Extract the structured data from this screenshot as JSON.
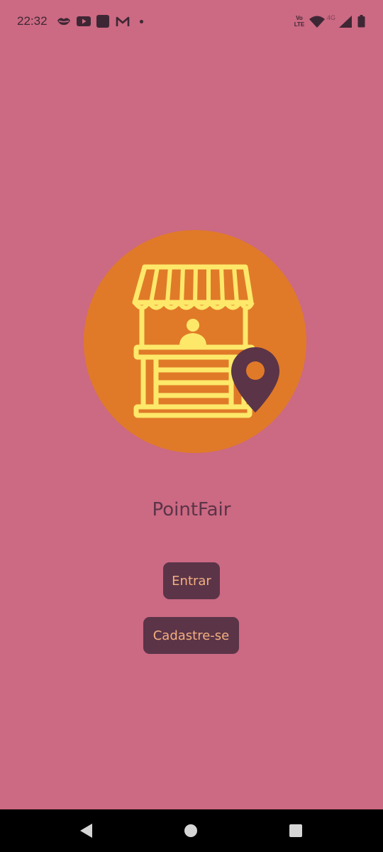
{
  "status_bar": {
    "time": "22:32",
    "network_label": "4G",
    "volte_label_top": "Vo",
    "volte_label_bottom": "LTE"
  },
  "app": {
    "title": "PointFair"
  },
  "buttons": {
    "login_label": "Entrar",
    "signup_label": "Cadastre-se"
  },
  "colors": {
    "background": "#cc6983",
    "logo_circle": "#e07a28",
    "stall": "#fde86a",
    "pin": "#5b3448",
    "button_bg": "#5b3448",
    "button_text": "#f3b07f"
  },
  "icons": {
    "status_left": [
      "lips-icon",
      "youtube-icon",
      "app-square-icon",
      "gmail-icon",
      "dot-icon"
    ],
    "status_right": [
      "volte-icon",
      "wifi-icon",
      "signal-icon",
      "battery-icon"
    ],
    "nav": [
      "back-icon",
      "home-icon",
      "recents-icon"
    ]
  }
}
